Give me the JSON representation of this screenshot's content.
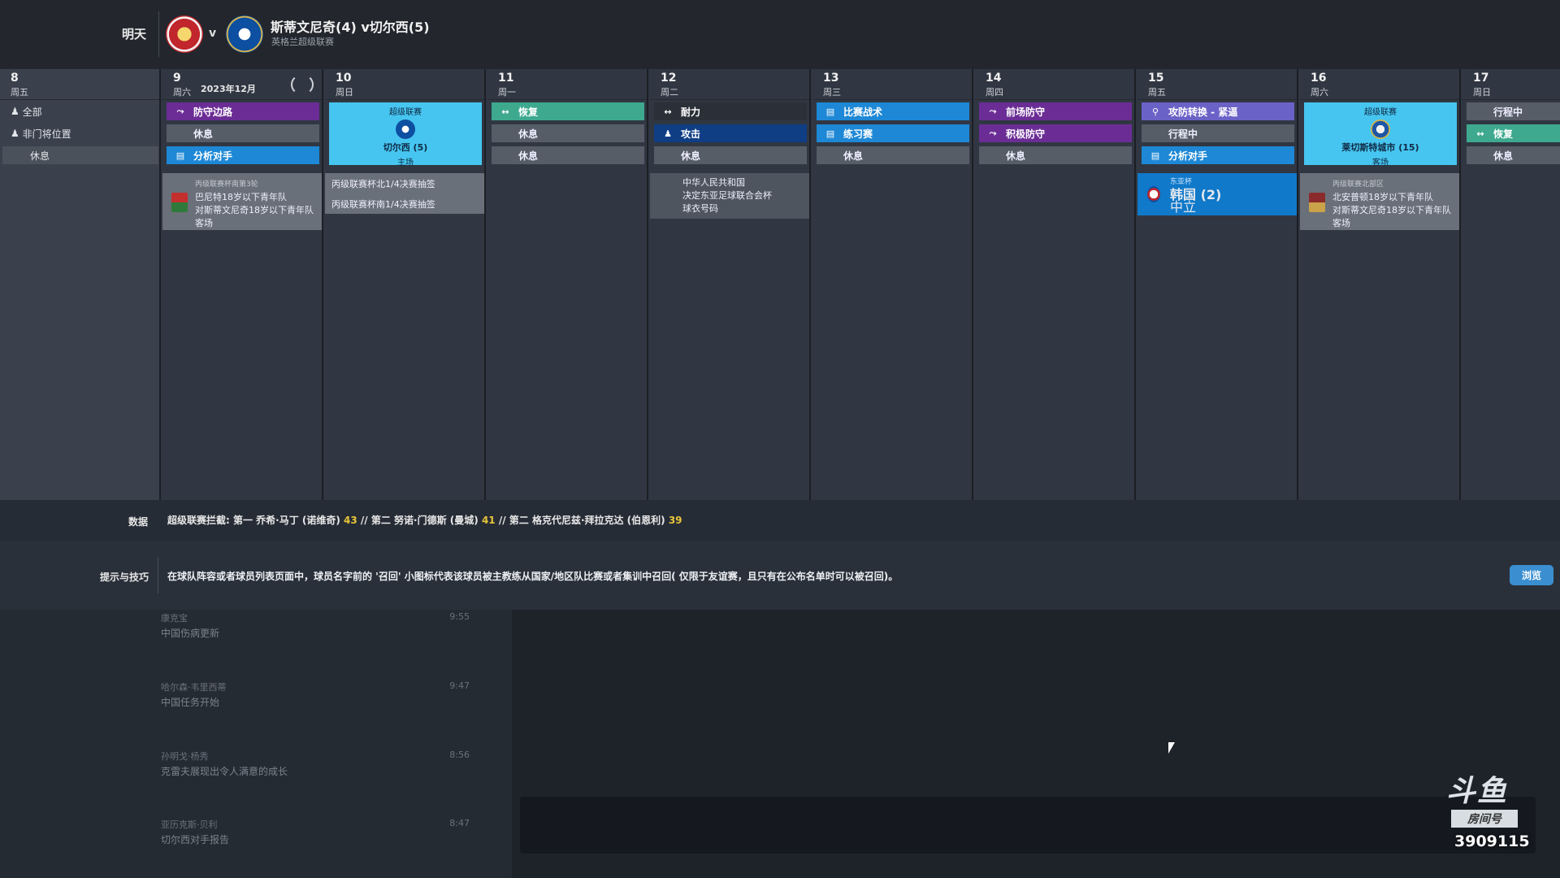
{
  "header": {
    "tomorrow": "明天",
    "vs": "v",
    "match_title": "斯蒂文尼奇(4) v切尔西(5)",
    "competition": "英格兰超级联赛"
  },
  "calendar": {
    "month_label": "2023年12月",
    "days": [
      {
        "num": "8",
        "week": "周五"
      },
      {
        "num": "9",
        "week": "周六"
      },
      {
        "num": "10",
        "week": "周日"
      },
      {
        "num": "11",
        "week": "周一"
      },
      {
        "num": "12",
        "week": "周二"
      },
      {
        "num": "13",
        "week": "周三"
      },
      {
        "num": "14",
        "week": "周四"
      },
      {
        "num": "15",
        "week": "周五"
      },
      {
        "num": "16",
        "week": "周六"
      },
      {
        "num": "17",
        "week": "周日"
      }
    ],
    "filters": {
      "all": "全部",
      "non_gk": "非门将位置",
      "rest": "休息"
    },
    "d9": {
      "s0": "防守边路",
      "s1": "休息",
      "s2": "分析对手"
    },
    "d10": {
      "comp": "超级联赛",
      "team": "切尔西 (5)",
      "venue": "主场"
    },
    "d11": {
      "s0": "恢复",
      "s1": "休息",
      "s2": "休息"
    },
    "d12": {
      "s0": "耐力",
      "s1": "攻击",
      "s2": "休息"
    },
    "d13": {
      "s0": "比赛战术",
      "s1": "练习赛",
      "s2": "休息"
    },
    "d14": {
      "s0": "前场防守",
      "s1": "积极防守",
      "s2": "休息"
    },
    "d15": {
      "s0": "攻防转换 - 紧逼",
      "s1": "行程中",
      "s2": "分析对手"
    },
    "d16": {
      "comp": "超级联赛",
      "team": "莱切斯特城市 (15)",
      "venue": "客场"
    },
    "d17": {
      "s0": "行程中",
      "s1": "恢复",
      "s2": "休息"
    },
    "events": {
      "e9_small": "丙级联赛杯南第3轮",
      "e9_l1": "巴尼特18岁以下青年队",
      "e9_l2": "对斯蒂文尼奇18岁以下青年队",
      "e9_l3": "客场",
      "e10_a": "丙级联赛杯北1/4决赛抽签",
      "e10_b": "丙级联赛杯南1/4决赛抽签",
      "e12_l1": "中华人民共和国",
      "e12_l2": "决定东亚足球联合会杯",
      "e12_l3": "球衣号码",
      "e15_small": "东亚杯",
      "e15_team": "韩国 (2)",
      "e15_venue": "中立",
      "e16_small": "丙级联赛北部区",
      "e16_l1": "北安普顿18岁以下青年队",
      "e16_l2": "对斯蒂文尼奇18岁以下青年队",
      "e16_l3": "客场"
    }
  },
  "stats": {
    "label": "数据",
    "prefix": "超级联赛拦截: 第一 乔希·马丁 (诺维奇) ",
    "n1": "43",
    "mid1": " // 第二 努诺·门德斯 (曼城) ",
    "n2": "41",
    "mid2": " // 第二 格克代尼兹·拜拉克达 (伯恩利) ",
    "n3": "39"
  },
  "tips": {
    "label": "提示与技巧",
    "text": "在球队阵容或者球员列表页面中，球员名字前的 '召回' 小图标代表该球员被主教练从国家/地区队比赛或者集训中召回( 仅限于友谊赛，且只有在公布名单时可以被召回)。",
    "browse": "浏览"
  },
  "news": [
    {
      "sender": "康克宝",
      "time": "9:55",
      "title": "中国伤病更新"
    },
    {
      "sender": "哈尔森·韦里西蒂",
      "time": "9:47",
      "title": "中国任务开始"
    },
    {
      "sender": "孙明戈·杨秀",
      "time": "8:56",
      "title": "克雷夫展现出令人满意的成长"
    },
    {
      "sender": "亚历克斯·贝利",
      "time": "8:47",
      "title": "切尔西对手报告"
    }
  ],
  "watermark": {
    "brand": "斗鱼",
    "room_label": "房间号",
    "room_number": "3909115"
  },
  "colors": {
    "purple": "#6b2d95",
    "dark_blue": "#0f3e85",
    "blue": "#1e88d6",
    "teal": "#3ea98f",
    "lavender": "#6b62c7",
    "match_card": "#46c5f0",
    "highlight_num": "#e7c53b"
  }
}
